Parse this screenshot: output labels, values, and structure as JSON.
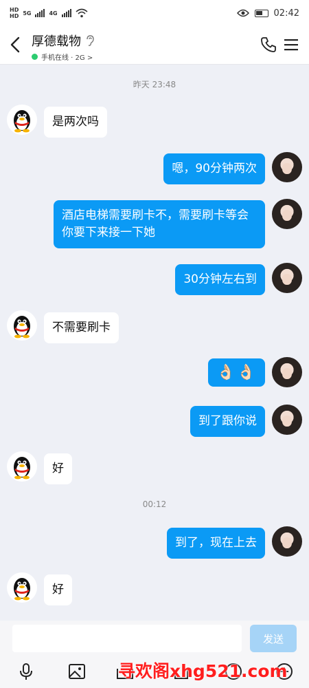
{
  "status_bar": {
    "sim1": "HD",
    "sim2": "HD",
    "net1": "5G",
    "net2": "4G",
    "time": "02:42"
  },
  "header": {
    "contact_name": "厚德载物",
    "online_status": "手机在线 · 2G >"
  },
  "timestamps": [
    "昨天 23:48",
    "00:12"
  ],
  "messages": [
    {
      "side": "in",
      "text": "是两次吗"
    },
    {
      "side": "out",
      "text": "嗯，90分钟两次"
    },
    {
      "side": "out",
      "text": "酒店电梯需要刷卡不，需要刷卡等会你要下来接一下她"
    },
    {
      "side": "out",
      "text": "30分钟左右到"
    },
    {
      "side": "in",
      "text": "不需要刷卡"
    },
    {
      "side": "out",
      "text": "👌🏻👌🏻"
    },
    {
      "side": "out",
      "text": "到了跟你说"
    },
    {
      "side": "in",
      "text": "好"
    },
    {
      "side": "out",
      "text": "到了，现在上去"
    },
    {
      "side": "in",
      "text": "好"
    }
  ],
  "input": {
    "placeholder": "",
    "send_label": "发送"
  },
  "toolbar_icons": [
    "microphone-icon",
    "image-icon",
    "camera-icon",
    "file-icon",
    "emoji-icon",
    "plus-icon"
  ],
  "watermark": "寻欢阁xhg521.com",
  "colors": {
    "outgoing_bubble": "#0b9af5",
    "incoming_bubble": "#ffffff",
    "background": "#eef0f6",
    "send_button": "#a6d4f7",
    "online_dot": "#2dcc70",
    "watermark": "#ff1e1e"
  }
}
